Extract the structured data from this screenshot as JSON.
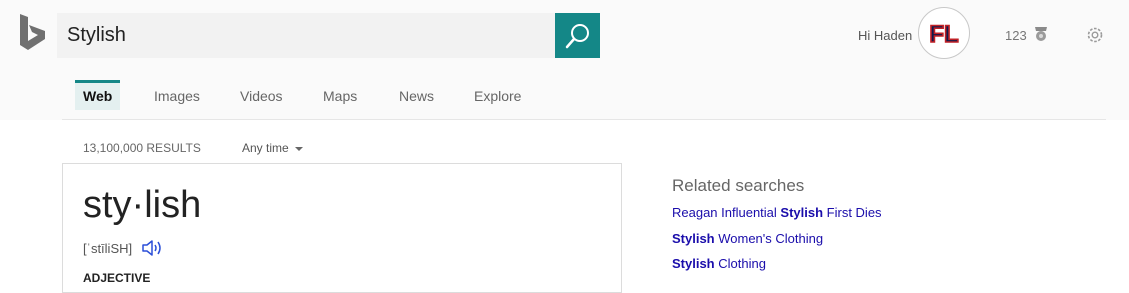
{
  "search": {
    "value": "Stylish"
  },
  "user": {
    "greeting": "Hi Haden",
    "avatar_text": "FL",
    "points": "123"
  },
  "nav": {
    "tabs": [
      "Web",
      "Images",
      "Videos",
      "Maps",
      "News",
      "Explore"
    ],
    "active": "Web"
  },
  "results": {
    "count": "13,100,000 RESULTS",
    "time_filter": "Any time"
  },
  "dictionary": {
    "word": "sty·lish",
    "pronunciation": "[ˈstīliSH]",
    "part_of_speech": "ADJECTIVE"
  },
  "related": {
    "title": "Related searches",
    "items": [
      {
        "before": "Reagan Influential ",
        "bold": "Stylish",
        "after": " First Dies"
      },
      {
        "before": "",
        "bold": "Stylish",
        "after": " Women's Clothing"
      },
      {
        "before": "",
        "bold": "Stylish",
        "after": " Clothing"
      }
    ]
  },
  "colors": {
    "accent": "#148787",
    "link": "#1a0dab"
  },
  "icons": [
    "bing-logo-icon",
    "search-icon",
    "trophy-icon",
    "gear-icon",
    "speaker-icon"
  ]
}
